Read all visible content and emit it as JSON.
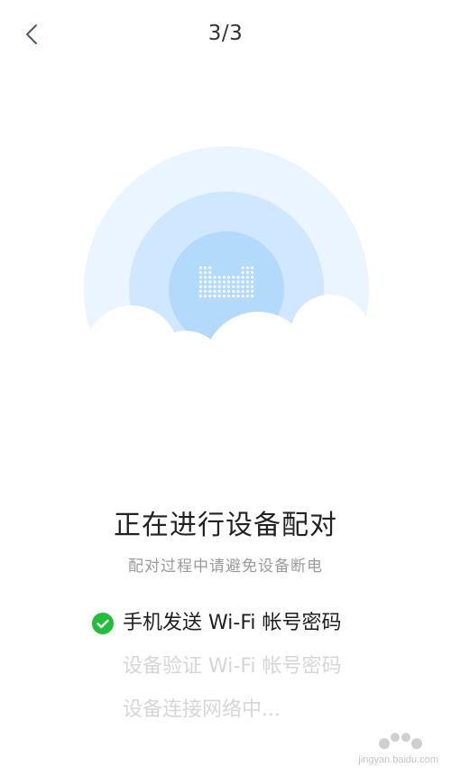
{
  "header": {
    "step_indicator": "3/3"
  },
  "main": {
    "title": "正在进行设备配对",
    "subtitle": "配对过程中请避免设备断电"
  },
  "steps": [
    {
      "label": "手机发送 Wi-Fi 帐号密码",
      "status": "done"
    },
    {
      "label": "设备验证 Wi-Fi 帐号密码",
      "status": "pending"
    },
    {
      "label": "设备连接网络中...",
      "status": "pending"
    }
  ],
  "watermark": {
    "text": "jingyan.baidu.com"
  },
  "colors": {
    "success": "#1fbf3a",
    "ring_outer": "#eaf5ff",
    "ring_middle": "#cfe7ff",
    "ring_inner": "#b3d9fb",
    "device": "#ffffff",
    "pending_text": "#d4d6da"
  }
}
